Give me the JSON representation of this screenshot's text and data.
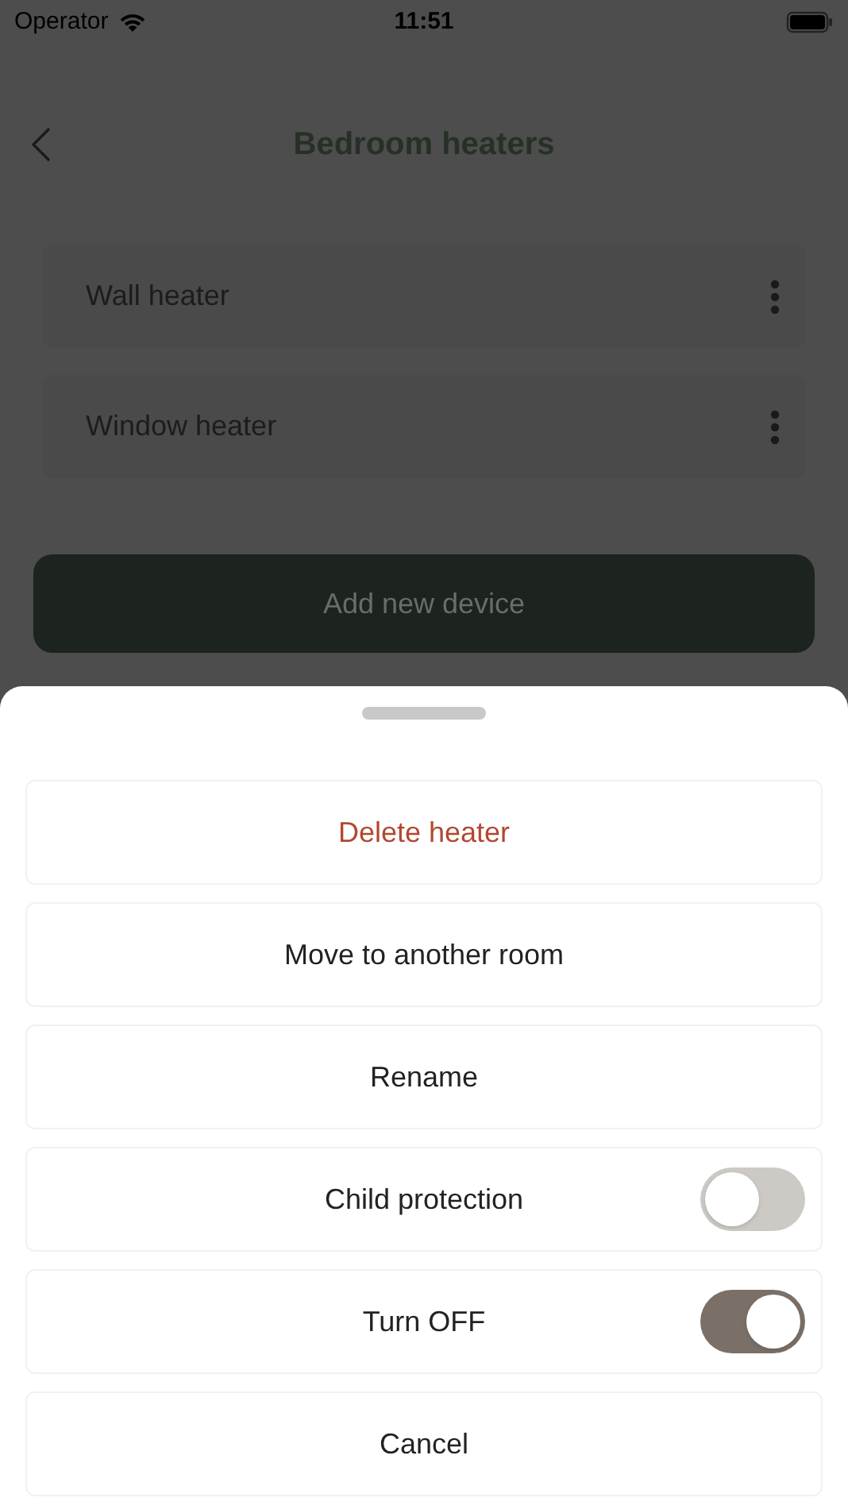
{
  "status_bar": {
    "carrier": "Operator",
    "time": "11:51"
  },
  "nav": {
    "title": "Bedroom heaters"
  },
  "devices": [
    {
      "name": "Wall heater"
    },
    {
      "name": "Window heater"
    }
  ],
  "add_button": {
    "label": "Add new device"
  },
  "sheet": {
    "actions": [
      {
        "kind": "destructive",
        "label": "Delete heater"
      },
      {
        "kind": "action",
        "label": "Move to another room"
      },
      {
        "kind": "action",
        "label": "Rename"
      },
      {
        "kind": "toggle",
        "label": "Child protection",
        "on": false
      },
      {
        "kind": "toggle",
        "label": "Turn OFF",
        "on": true
      },
      {
        "kind": "action",
        "label": "Cancel"
      }
    ]
  }
}
